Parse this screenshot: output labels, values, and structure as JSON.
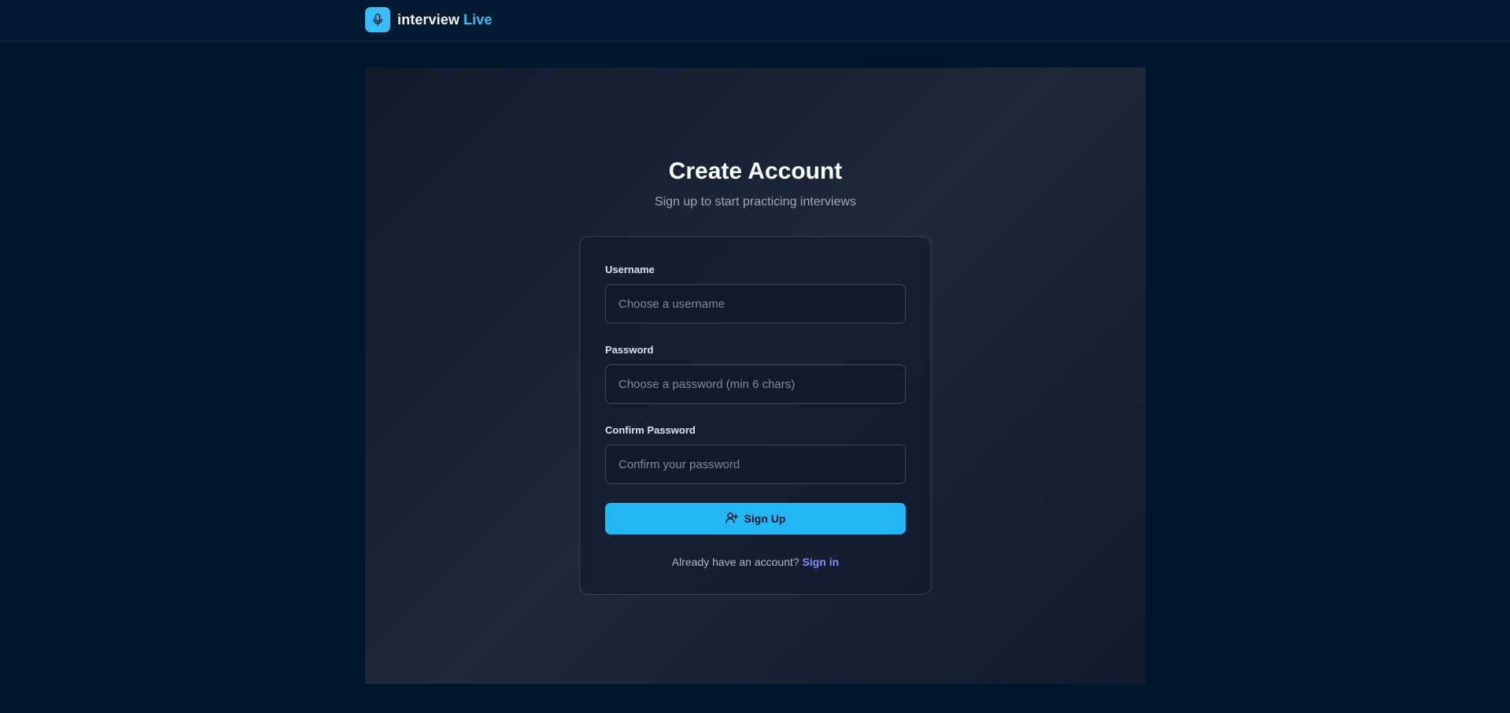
{
  "header": {
    "brand_main": "interview",
    "brand_accent": "Live",
    "logo_icon": "microphone-icon"
  },
  "signup": {
    "title": "Create Account",
    "subtitle": "Sign up to start practicing interviews",
    "username": {
      "label": "Username",
      "placeholder": "Choose a username",
      "value": ""
    },
    "password": {
      "label": "Password",
      "placeholder": "Choose a password (min 6 chars)",
      "value": ""
    },
    "confirm_password": {
      "label": "Confirm Password",
      "placeholder": "Confirm your password",
      "value": ""
    },
    "submit_label": "Sign Up",
    "submit_icon": "user-plus-icon",
    "footer_prompt": "Already have an account?",
    "signin_link": "Sign in"
  },
  "colors": {
    "page_bg": "#00162a",
    "accent": "#38bdf8",
    "button": "#23b6f5",
    "link": "#818cf8"
  }
}
